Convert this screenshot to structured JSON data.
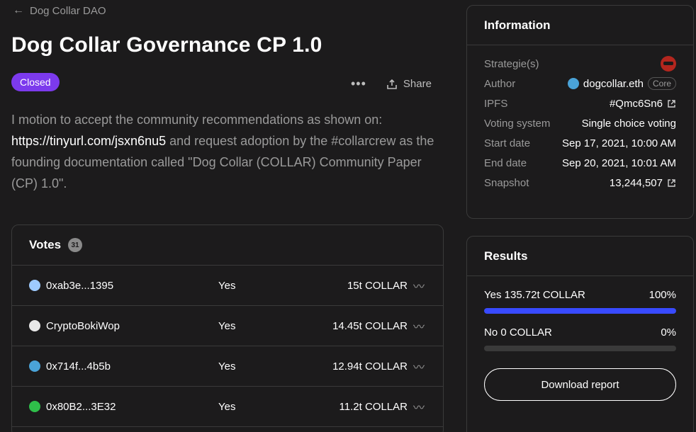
{
  "back_link": "Dog Collar DAO",
  "title": "Dog Collar Governance CP 1.0",
  "status_badge": "Closed",
  "share_label": "Share",
  "body": {
    "line_start": "I motion to accept the community recommendations as shown on:",
    "link": "https://tinyurl.com/jsxn6nu5",
    "line_end": " and request adoption by the #collarcrew as the founding documentation called \"Dog Collar (COLLAR) Community Paper (CP) 1.0\"."
  },
  "votes": {
    "heading": "Votes",
    "count": "31",
    "rows": [
      {
        "voter": "0xab3e...1395",
        "choice": "Yes",
        "power": "15t COLLAR",
        "avatar_color": "#9ecbff"
      },
      {
        "voter": "CryptoBokiWop",
        "choice": "Yes",
        "power": "14.45t COLLAR",
        "avatar_color": "#e8e8e8"
      },
      {
        "voter": "0x714f...4b5b",
        "choice": "Yes",
        "power": "12.94t COLLAR",
        "avatar_color": "#4aa3d8"
      },
      {
        "voter": "0x80B2...3E32",
        "choice": "Yes",
        "power": "11.2t COLLAR",
        "avatar_color": "#2fbf4a"
      }
    ]
  },
  "information": {
    "heading": "Information",
    "strategies_label": "Strategie(s)",
    "author_label": "Author",
    "author_value": "dogcollar.eth",
    "author_badge": "Core",
    "ipfs_label": "IPFS",
    "ipfs_value": "#Qmc6Sn6",
    "voting_system_label": "Voting system",
    "voting_system_value": "Single choice voting",
    "start_label": "Start date",
    "start_value": "Sep 17, 2021, 10:00 AM",
    "end_label": "End date",
    "end_value": "Sep 20, 2021, 10:01 AM",
    "snapshot_label": "Snapshot",
    "snapshot_value": "13,244,507"
  },
  "results": {
    "heading": "Results",
    "options": [
      {
        "label": "Yes 135.72t COLLAR",
        "percent": "100%",
        "fraction": 1.0
      },
      {
        "label": "No 0 COLLAR",
        "percent": "0%",
        "fraction": 0.0
      }
    ],
    "download_label": "Download report"
  },
  "colors": {
    "accent": "#384aff",
    "closed_badge": "#7c3aed",
    "background": "#1c1b1c"
  }
}
